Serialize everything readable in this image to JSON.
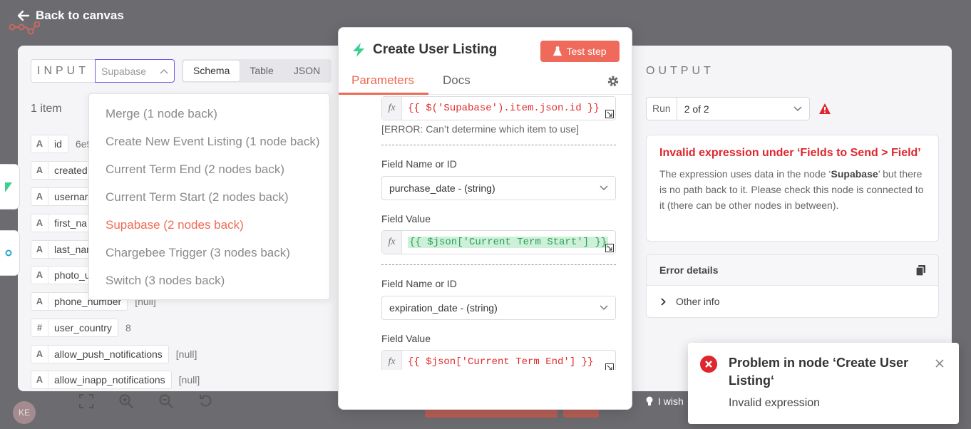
{
  "canvas": {
    "back_label": "Back to canvas",
    "avatar_initials": "KE",
    "wish_text": "I wish"
  },
  "input": {
    "title": "INPUT",
    "node_select_value": "Supabase",
    "modes": [
      "Schema",
      "Table",
      "JSON"
    ],
    "item_count": "1 item",
    "fields": [
      {
        "type": "A",
        "key": "id",
        "value": "6e9"
      },
      {
        "type": "A",
        "key": "created",
        "value": ""
      },
      {
        "type": "A",
        "key": "usernar",
        "value": ""
      },
      {
        "type": "A",
        "key": "first_na",
        "value": ""
      },
      {
        "type": "A",
        "key": "last_nar",
        "value": ""
      },
      {
        "type": "A",
        "key": "photo_u",
        "value": ""
      },
      {
        "type": "A",
        "key": "phone_number",
        "value": "[null]"
      },
      {
        "type": "#",
        "key": "user_country",
        "value": "8"
      },
      {
        "type": "A",
        "key": "allow_push_notifications",
        "value": "[null]"
      },
      {
        "type": "A",
        "key": "allow_inapp_notifications",
        "value": "[null]"
      }
    ],
    "dropdown": [
      "Merge (1 node back)",
      "Create New Event Listing (1 node back)",
      "Current Term End (2 nodes back)",
      "Current Term Start (2 nodes back)",
      "Supabase (2 nodes back)",
      "Chargebee Trigger (3 nodes back)",
      "Switch (3 nodes back)"
    ],
    "dropdown_selected_index": 4
  },
  "params": {
    "title": "Create User Listing",
    "test_step": "Test step",
    "tabs": [
      "Parameters",
      "Docs"
    ],
    "fx": "fx",
    "expr1": "{{ $('Supabase').item.json.id }}",
    "error1": "[ERROR: Can’t determine which item to use]",
    "field_name_label": "Field Name or ID",
    "field_value_label": "Field Value",
    "field2_name": "purchase_date - (string)",
    "field2_value": "{{ $json['Current Term Start'] }}",
    "field3_name": "expiration_date - (string)",
    "field3_value": "{{ $json['Current Term End'] }}"
  },
  "output": {
    "title": "OUTPUT",
    "run_label": "Run",
    "run_value": "2 of 2",
    "error_title": "Invalid expression under ‘Fields to Send > Field’",
    "error_p1": "The expression uses data in the node ‘",
    "error_node": "Supabase",
    "error_p2": "’ but there is no path back to it. Please check this node is connected to it (there can be other nodes in between).",
    "details_title": "Error details",
    "other_info": "Other info"
  },
  "toast": {
    "title": "Problem in node ‘Create User Listing‘",
    "message": "Invalid expression"
  },
  "colors": {
    "accent": "#ef6a55",
    "error": "#e0262d",
    "select_border": "#6d5ce7",
    "success": "#2f9e55"
  }
}
